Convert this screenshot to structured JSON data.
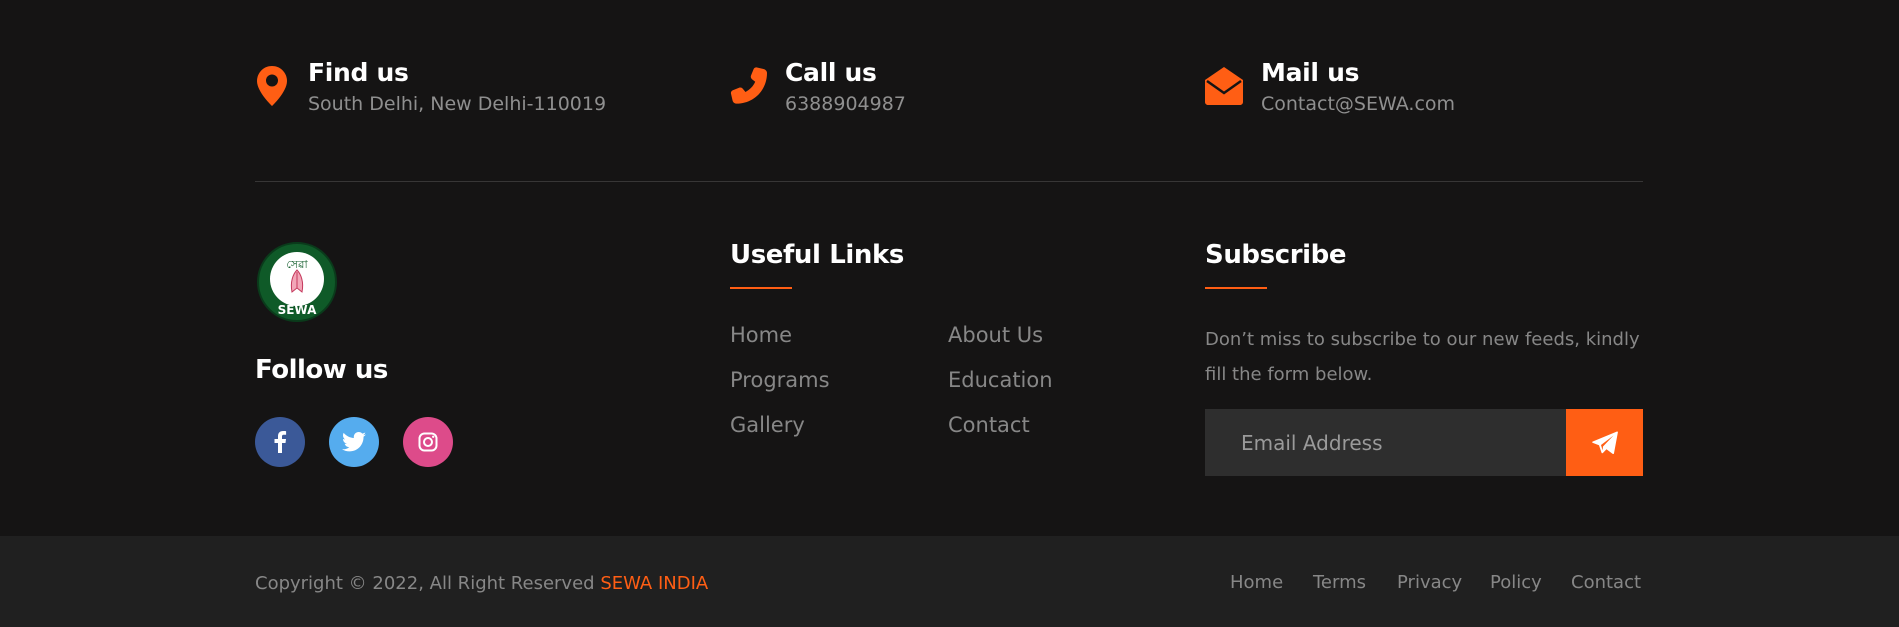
{
  "contact": {
    "find": {
      "title": "Find us",
      "sub": "South Delhi, New Delhi-110019",
      "icon": "map-marker-icon"
    },
    "call": {
      "title": "Call us",
      "sub": "6388904987",
      "icon": "phone-icon"
    },
    "mail": {
      "title": "Mail us",
      "sub": "Contact@SEWA.com",
      "icon": "envelope-open-icon"
    }
  },
  "logo": {
    "text": "SEWA"
  },
  "follow": {
    "title": "Follow us"
  },
  "social": [
    {
      "name": "facebook",
      "color": "#3b5998"
    },
    {
      "name": "twitter",
      "color": "#55acee"
    },
    {
      "name": "instagram",
      "color": "#dd4b8a"
    }
  ],
  "useful_links": {
    "title": "Useful Links",
    "left": [
      "Home",
      "Programs",
      "Gallery"
    ],
    "right": [
      "About Us",
      "Education",
      "Contact"
    ]
  },
  "subscribe": {
    "title": "Subscribe",
    "text": "Don’t miss to subscribe to our new feeds, kindly fill the form below.",
    "placeholder": "Email Address"
  },
  "bottom": {
    "copyright": "Copyright © 2022, All Right Reserved ",
    "brand": "SEWA INDIA",
    "links": [
      "Home",
      "Terms",
      "Privacy",
      "Policy",
      "Contact"
    ]
  },
  "colors": {
    "accent": "#ff5e14",
    "bg": "#151414",
    "bottom_bg": "#202020"
  }
}
